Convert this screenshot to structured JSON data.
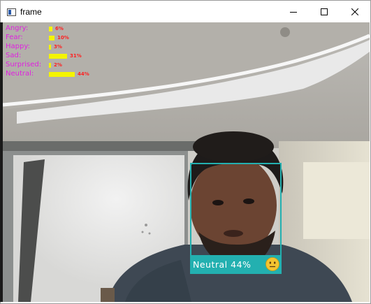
{
  "window": {
    "title": "frame",
    "controls": {
      "minimize_icon": "minimize-icon",
      "maximize_icon": "maximize-icon",
      "close_icon": "close-icon"
    }
  },
  "emotions": [
    {
      "label": "Angry:",
      "percent": 6,
      "percent_text": "6%"
    },
    {
      "label": "Fear:",
      "percent": 10,
      "percent_text": "10%"
    },
    {
      "label": "Happy:",
      "percent": 3,
      "percent_text": "3%"
    },
    {
      "label": "Sad:",
      "percent": 31,
      "percent_text": "31%"
    },
    {
      "label": "Surprised:",
      "percent": 2,
      "percent_text": "2%"
    },
    {
      "label": "Neutral:",
      "percent": 44,
      "percent_text": "44%"
    }
  ],
  "colors": {
    "emotion_label": "#e020e0",
    "bar": "#f4f400",
    "percent_text": "#ff2020",
    "face_box": "#23b0b0"
  },
  "face": {
    "label": "Neutral 44%",
    "emoji_icon": "neutral-face-emoji-icon"
  }
}
